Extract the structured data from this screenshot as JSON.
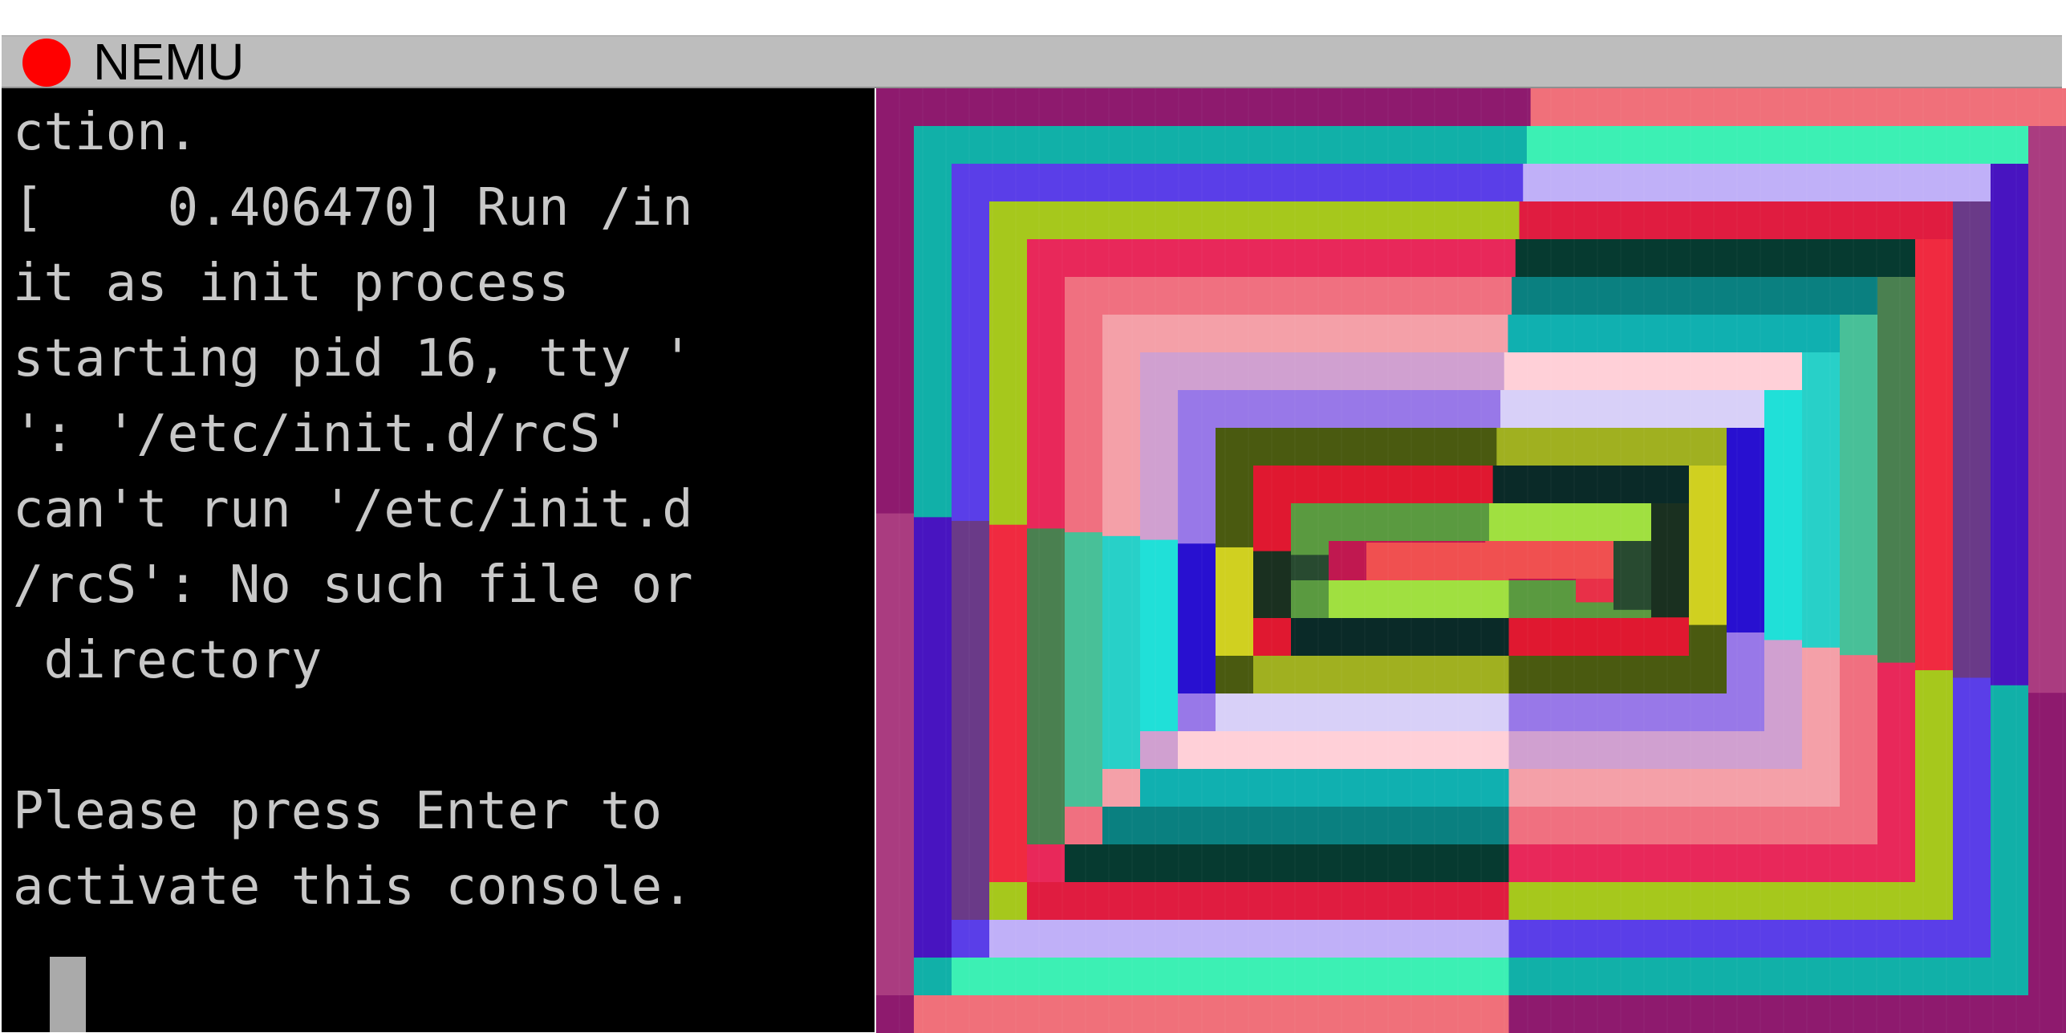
{
  "window": {
    "title": "NEMU"
  },
  "terminal": {
    "lines": [
      "ction.",
      "[    0.406470] Run /in",
      "it as init process",
      "starting pid 16, tty '",
      "': '/etc/init.d/rcS'",
      "can't run '/etc/init.d",
      "/rcS': No such file or",
      " directory",
      "",
      "Please press Enter to",
      "activate this console."
    ]
  },
  "colors": {
    "titlebar": "#bdbdbd",
    "close_button": "#ff0000",
    "terminal_bg": "#000000",
    "terminal_text": "#c8c8c8",
    "cursor": "#aaaaaa"
  },
  "display": {
    "description_icon": "pixel-spiral-pattern",
    "frames": [
      [
        "#8e1a6e",
        "#f0707a",
        "#aa3c80"
      ],
      [
        "#11b0a8",
        "#3cf0b4",
        "#4814c0",
        "#7030c0"
      ],
      [
        "#5a3ee8",
        "#c0b0f8",
        "#6a3a88"
      ],
      [
        "#a6c81c",
        "#e01c40",
        "#f02a40"
      ],
      [
        "#e8285a",
        "#063a30",
        "#4a8050"
      ],
      [
        "#f07080",
        "#0a8080",
        "#48c098"
      ],
      [
        "#f4a0a8",
        "#10b0b0",
        "#28d0c8"
      ],
      [
        "#d0a0d0",
        "#ffd0d8",
        "#20e0d8"
      ],
      [
        "#9878e8",
        "#d8d0f8",
        "#2810d0"
      ],
      [
        "#4a5a10",
        "#a0b020",
        "#d0d020"
      ],
      [
        "#e01830",
        "#0a2a28",
        "#1a3020"
      ],
      [
        "#5a9a40",
        "#a0e040",
        "#284a30"
      ],
      [
        "#c01850",
        "#f05050",
        "#e83048"
      ],
      [
        "#208050",
        "#58a060",
        "#0a5a50"
      ],
      [
        "#60c060",
        "#90f080",
        "#60c870"
      ]
    ],
    "center": "#900060"
  }
}
